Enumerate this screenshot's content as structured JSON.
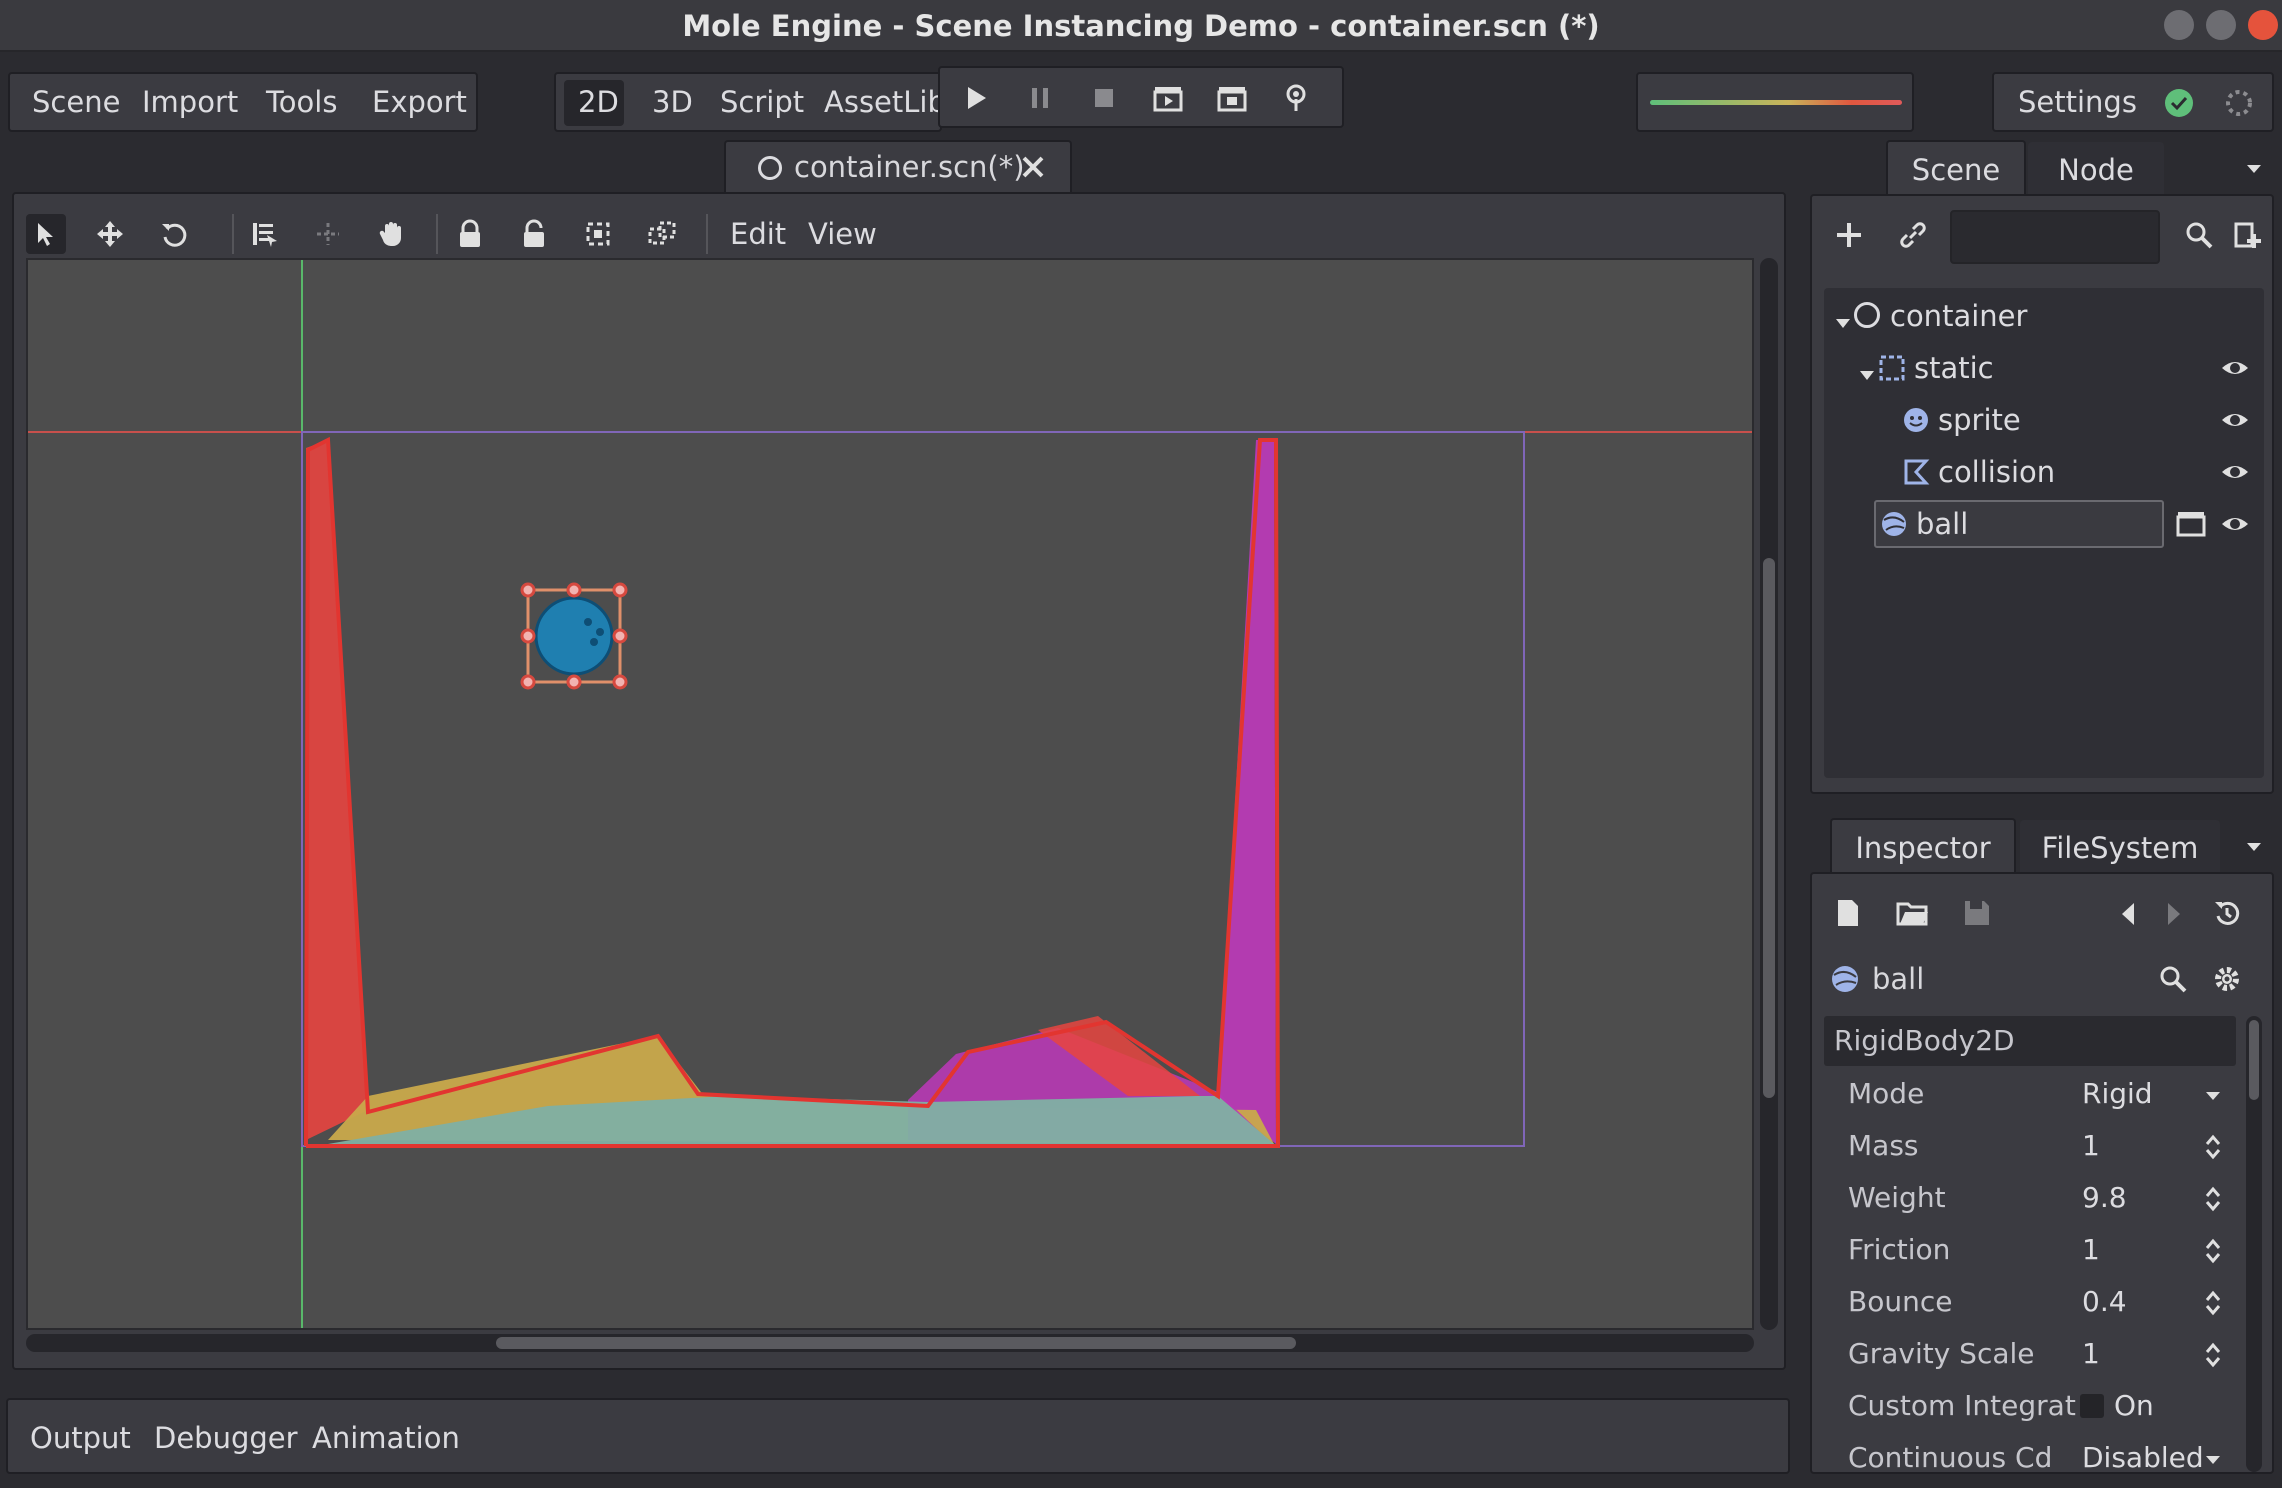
{
  "window": {
    "title": "Mole Engine - Scene Instancing Demo - container.scn (*)"
  },
  "menu": {
    "items": [
      "Scene",
      "Import",
      "Tools",
      "Export"
    ]
  },
  "modes": {
    "items": [
      "2D",
      "3D",
      "Script",
      "AssetLib"
    ],
    "active": "2D"
  },
  "play_controls": [
    "play-icon",
    "pause-icon",
    "stop-icon",
    "play-scene-icon",
    "play-custom-scene-icon",
    "remote-debug-icon"
  ],
  "settings": {
    "label": "Settings"
  },
  "editor_tab": {
    "label": "container.scn(*)"
  },
  "viewport_toolbar": {
    "edit_label": "Edit",
    "view_label": "View"
  },
  "scene_dock": {
    "tabs": [
      "Scene",
      "Node"
    ],
    "active_tab": "Scene",
    "tree": [
      {
        "label": "container",
        "icon": "node2d-icon",
        "depth": 0
      },
      {
        "label": "static",
        "icon": "staticbody-icon",
        "depth": 1
      },
      {
        "label": "sprite",
        "icon": "sprite-icon",
        "depth": 2
      },
      {
        "label": "collision",
        "icon": "collision-polygon-icon",
        "depth": 2
      },
      {
        "label": "ball",
        "icon": "rigidbody-icon",
        "depth": 1,
        "editing": true
      }
    ]
  },
  "inspector_dock": {
    "tabs": [
      "Inspector",
      "FileSystem"
    ],
    "active_tab": "Inspector",
    "object_name": "ball",
    "section": "RigidBody2D",
    "properties": [
      {
        "name": "Mode",
        "value": "Rigid",
        "control": "dropdown"
      },
      {
        "name": "Mass",
        "value": "1",
        "control": "spin"
      },
      {
        "name": "Weight",
        "value": "9.8",
        "control": "spin"
      },
      {
        "name": "Friction",
        "value": "1",
        "control": "spin"
      },
      {
        "name": "Bounce",
        "value": "0.4",
        "control": "spin"
      },
      {
        "name": "Gravity Scale",
        "value": "1",
        "control": "spin"
      },
      {
        "name": "Custom Integrat",
        "value": "On",
        "control": "checkbox"
      },
      {
        "name": "Continuous Cd",
        "value": "Disabled",
        "control": "dropdown"
      }
    ]
  },
  "bottom_panel": {
    "tabs": [
      "Output",
      "Debugger",
      "Animation"
    ]
  },
  "colors": {
    "background": "#2b2b30",
    "panel": "#3b3b41",
    "viewport": "#4d4d4d",
    "accent_green": "#5fbf7a",
    "red_shape": "#e84540",
    "magenta_shape": "#b83ab5",
    "yellow_shape": "#c9a94b",
    "teal_shape": "#7fb0a3",
    "ball_blue": "#1f7fb0"
  }
}
